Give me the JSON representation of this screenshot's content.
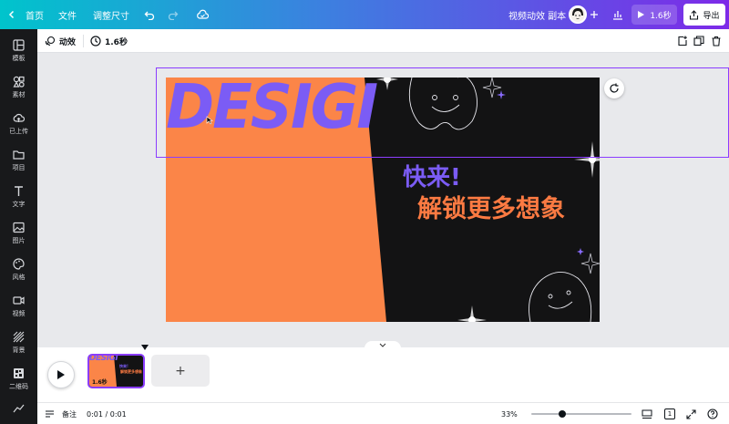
{
  "topbar": {
    "home": "首页",
    "file": "文件",
    "resize": "调整尺寸",
    "doc_title": "视频动效 副本",
    "duration": "1.6秒",
    "export": "导出"
  },
  "sidebar": {
    "items": [
      {
        "label": "模板",
        "icon": "layout-icon"
      },
      {
        "label": "素材",
        "icon": "elements-icon"
      },
      {
        "label": "已上传",
        "icon": "upload-icon"
      },
      {
        "label": "项目",
        "icon": "folder-icon"
      },
      {
        "label": "文字",
        "icon": "text-icon"
      },
      {
        "label": "图片",
        "icon": "image-icon"
      },
      {
        "label": "风格",
        "icon": "palette-icon"
      },
      {
        "label": "视频",
        "icon": "video-icon"
      },
      {
        "label": "背景",
        "icon": "background-icon"
      },
      {
        "label": "二维码",
        "icon": "qrcode-icon"
      }
    ]
  },
  "toolbar": {
    "animate": "动效",
    "duration": "1.6秒"
  },
  "slide": {
    "heading": "DESIGI",
    "line1": "快来!",
    "line2": "解锁更多想象",
    "colors": {
      "orange": "#fb8548",
      "dark": "#131314",
      "purple": "#7b5cf5",
      "text_orange": "#fb7a42"
    }
  },
  "timeline": {
    "thumb_duration": "1.6秒",
    "thumb_heading": "DESIGI",
    "thumb_line1": "快来!",
    "thumb_line2": "解锁更多想象",
    "add_page": "+"
  },
  "status": {
    "notes": "备注",
    "time": "0:01 / 0:01",
    "zoom": "33%",
    "zoom_level": 0.33,
    "page_number": "1"
  }
}
